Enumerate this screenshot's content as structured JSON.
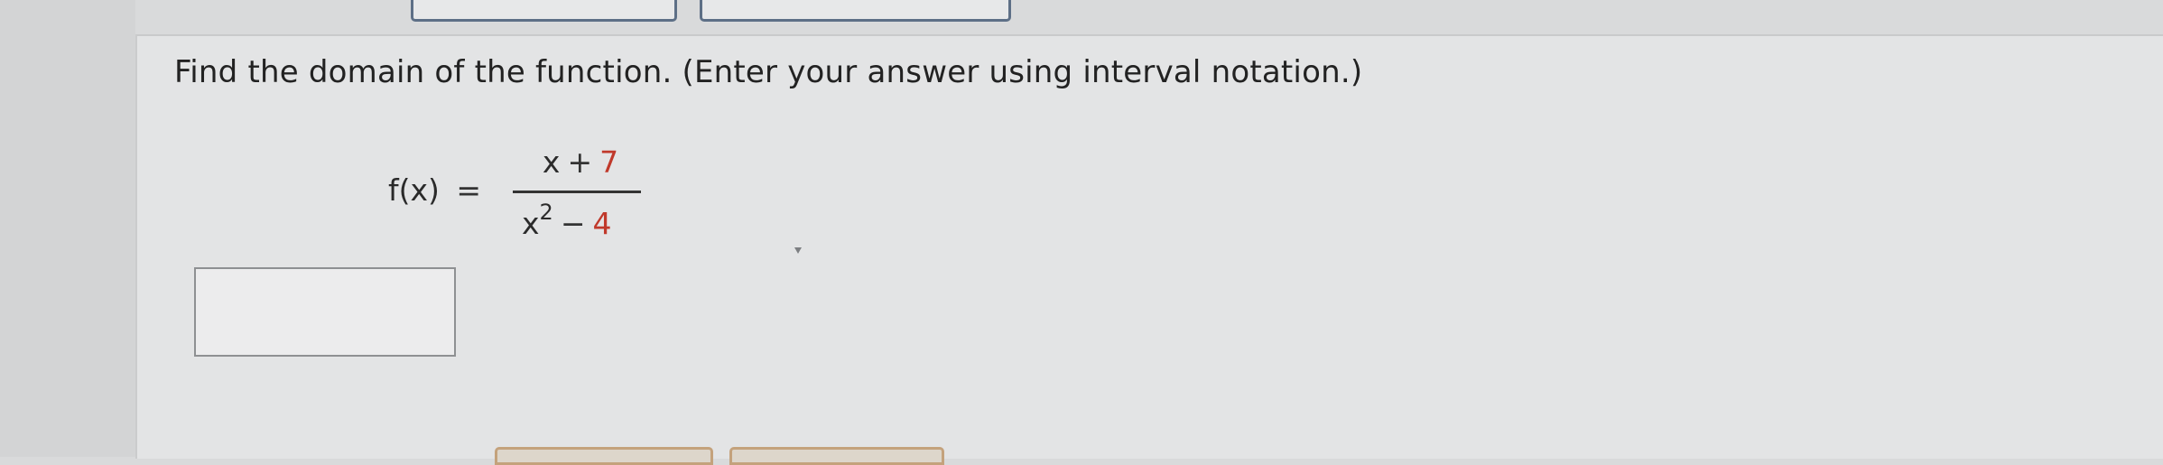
{
  "question": {
    "prompt": "Find the domain of the function. (Enter your answer using interval notation.)"
  },
  "formula": {
    "lhs": "f(x)",
    "equals": "=",
    "numerator": {
      "variable": "x",
      "operator": "+",
      "constant": "7"
    },
    "denominator": {
      "variable": "x",
      "exponent": "2",
      "operator": "−",
      "constant": "4"
    }
  },
  "answer": {
    "value": "",
    "placeholder": ""
  },
  "colors": {
    "constant_red": "#c0392b",
    "text": "#222222",
    "button_border_blue": "#5d6f86",
    "button_border_tan": "#c4a27c"
  }
}
